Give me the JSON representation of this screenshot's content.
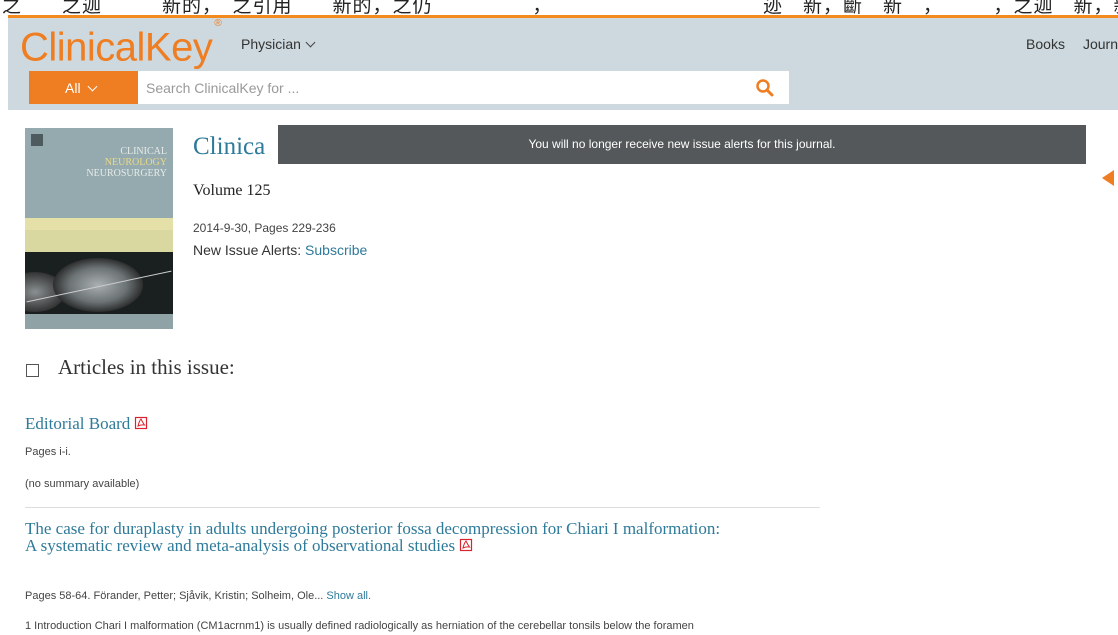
{
  "top_strip_text": "之　　之迦　　　新的，　之引用　　新的，之仍　　　　　，　　　　　　　　　　　迹　新，斷　新　，　　　，之迦　新，新，新　　之　　新，新，新的",
  "header": {
    "logo": "ClinicalKey",
    "logo_mark": "®",
    "role_label": "Physician",
    "nav_links": [
      "Books",
      "Journ"
    ]
  },
  "search": {
    "scope_label": "All",
    "placeholder": "Search ClinicalKey for ..."
  },
  "journal": {
    "cover": {
      "title_lines": [
        "Clinical",
        "Neurology",
        "Neurosurgery"
      ]
    },
    "title": "Clinica",
    "volume": "Volume 125",
    "date_pages": "2014-9-30, Pages 229-236",
    "alerts_label": "New Issue Alerts:",
    "alerts_link": "Subscribe"
  },
  "toast": {
    "message": "You will no longer receive new issue alerts for this journal."
  },
  "articles_heading": "Articles in this issue:",
  "articles": [
    {
      "title": "Editorial Board",
      "meta": "Pages i-i.",
      "summary": "(no summary available)"
    },
    {
      "title": "The case for duraplasty in adults undergoing posterior fossa decompression for Chiari I malformation: A systematic review and meta-analysis of observational studies",
      "meta": "Pages 58-64. Förander, Petter; Sjåvik, Kristin; Solheim, Ole... ",
      "meta_link": "Show all.",
      "summary": "1 Introduction Chari I malformation (CM1acrnm1) is usually defined radiologically as herniation of the cerebellar tonsils below the foramen"
    }
  ],
  "colors": {
    "brand_orange": "#ef7d22",
    "header_bg": "#cdd9de",
    "link_blue": "#2e7a9a",
    "toast_bg": "#54585a"
  }
}
